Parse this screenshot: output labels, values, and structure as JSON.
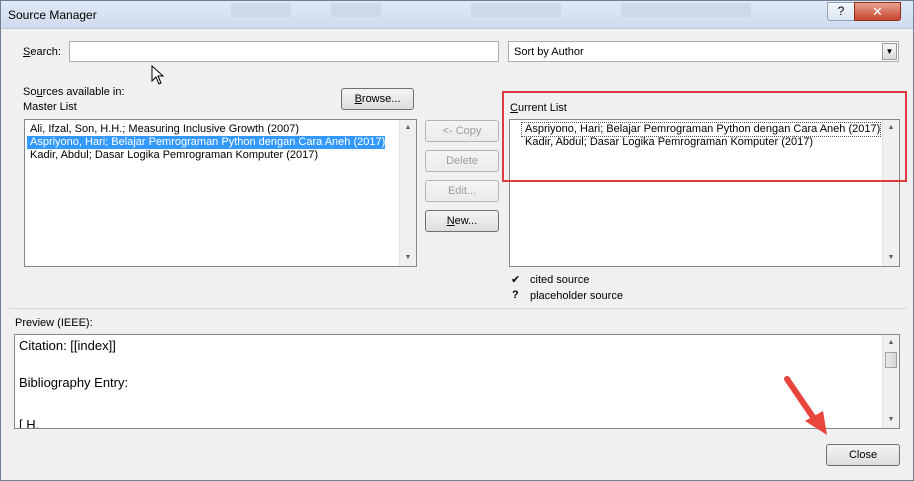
{
  "window": {
    "title": "Source Manager",
    "help_label": "?",
    "close_label": "✕"
  },
  "search": {
    "label_first": "S",
    "label_rest": "earch:",
    "value": "",
    "placeholder": ""
  },
  "sort": {
    "selected": "Sort by Author",
    "arrow_icon": "chevron-down-icon"
  },
  "master": {
    "label_line1_pre": "So",
    "label_line1_u": "u",
    "label_line1_post": "rces available in:",
    "label_line2": "Master List",
    "browse_label_u": "B",
    "browse_label_rest": "rowse...",
    "items": [
      "Ali, Ifzal, Son, H.H.; Measuring Inclusive Growth (2007)",
      "Aspriyono, Hari; Belajar Pemrograman Python dengan Cara Aneh (2017)",
      "Kadir, Abdul; Dasar Logika Pemrograman Komputer (2017)"
    ],
    "selected_index": 1
  },
  "actions": {
    "copy": "<- Copy",
    "delete": "Delete",
    "edit": "Edit...",
    "new_u": "N",
    "new_rest": "ew..."
  },
  "current": {
    "label_u": "C",
    "label_rest": "urrent List",
    "items": [
      "Aspriyono, Hari; Belajar Pemrograman Python dengan Cara Aneh (2017)",
      "Kadir, Abdul; Dasar Logika Pemrograman Komputer (2017)"
    ]
  },
  "legend": {
    "cited_mark": "✔",
    "cited_text": "cited source",
    "placeholder_mark": "?",
    "placeholder_text": "placeholder source"
  },
  "preview": {
    "label": "Preview (IEEE):",
    "lines": [
      "Citation:  [[index]]",
      "Bibliography Entry:",
      "[ H."
    ]
  },
  "close_button": "Close",
  "colors": {
    "selection": "#3399ff",
    "highlight_box": "#e0393e",
    "annotation_arrow": "#e8453c"
  }
}
